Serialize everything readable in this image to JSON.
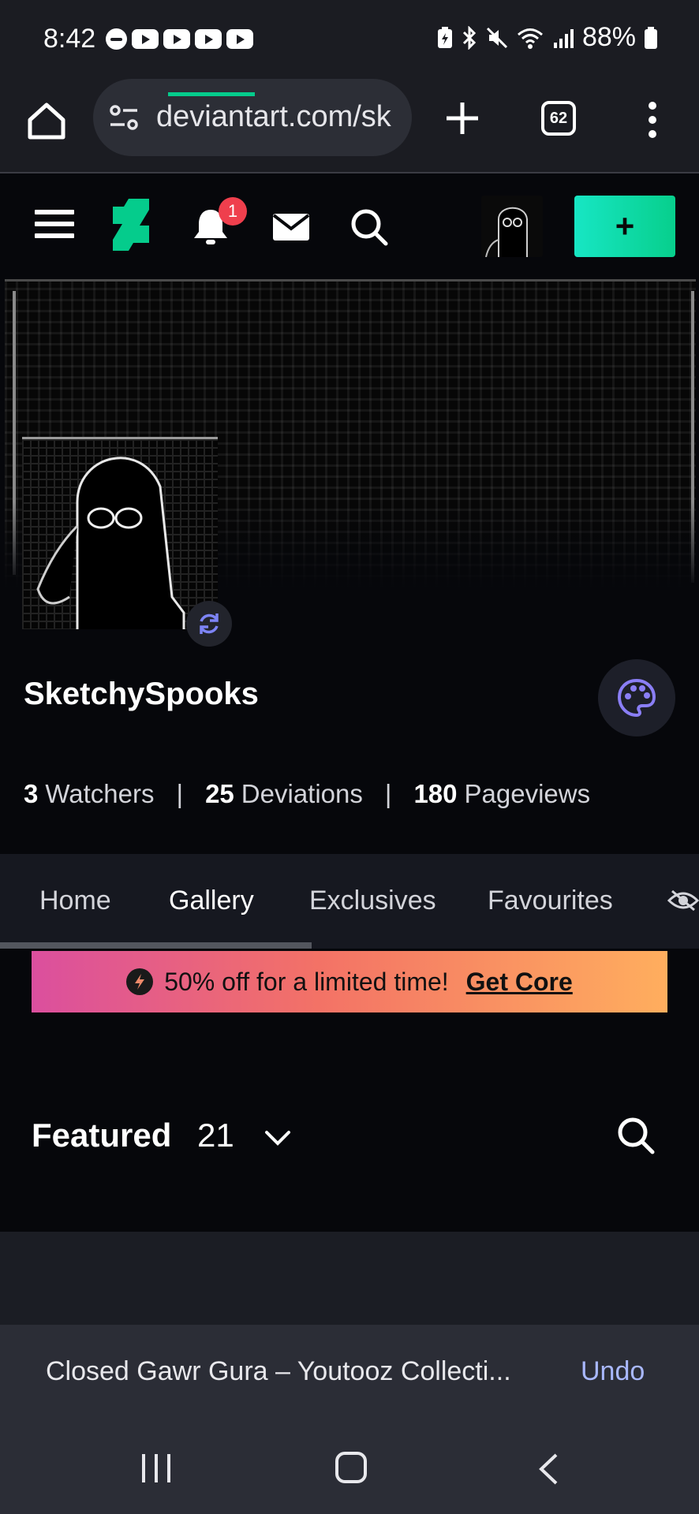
{
  "status_bar": {
    "time": "8:42",
    "battery": "88%",
    "left_icons": [
      "do-not-disturb-icon",
      "youtube-icon",
      "youtube-icon",
      "youtube-icon",
      "youtube-icon"
    ],
    "right_icons": [
      "battery-saver-icon",
      "bluetooth-icon",
      "mute-icon",
      "wifi-icon",
      "signal-icon",
      "battery-icon"
    ]
  },
  "browser": {
    "url": "deviantart.com/sk",
    "tab_count": "62"
  },
  "header": {
    "notification_count": "1",
    "create_label": "+",
    "accent": "#05cc8c"
  },
  "profile": {
    "username": "SketchySpooks",
    "stats": [
      {
        "value": "3",
        "label": "Watchers"
      },
      {
        "value": "25",
        "label": "Deviations"
      },
      {
        "value": "180",
        "label": "Pageviews"
      }
    ],
    "separator": "|"
  },
  "tabs": [
    {
      "label": "Home"
    },
    {
      "label": "Gallery",
      "active": true
    },
    {
      "label": "Exclusives"
    },
    {
      "label": "Favourites"
    }
  ],
  "promo": {
    "text": "50% off for a limited time!",
    "cta": "Get Core"
  },
  "featured": {
    "title": "Featured",
    "count": "21"
  },
  "snackbar": {
    "message": "Closed Gawr Gura – Youtooz Collecti...",
    "action": "Undo"
  }
}
